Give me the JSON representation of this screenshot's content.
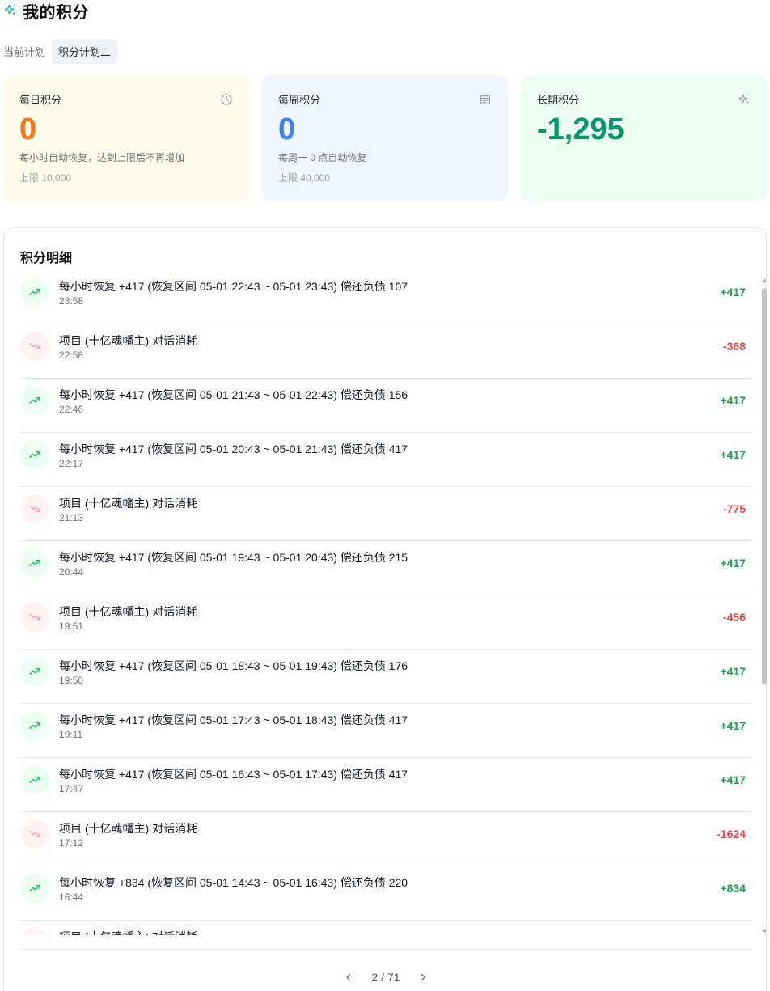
{
  "header": {
    "title": "我的积分"
  },
  "plan": {
    "label": "当前计划",
    "current": "积分计划二"
  },
  "cards": {
    "daily": {
      "label": "每日积分",
      "value": "0",
      "desc": "每小时自动恢复，达到上限后不再增加",
      "limit": "上限 10,000",
      "icon": "clock-icon"
    },
    "weekly": {
      "label": "每周积分",
      "value": "0",
      "desc": "每周一 0 点自动恢复",
      "limit": "上限 40,000",
      "icon": "calendar-icon"
    },
    "long": {
      "label": "长期积分",
      "value": "-1,295",
      "icon": "sparkle-icon"
    }
  },
  "details": {
    "title": "积分明细",
    "rows": [
      {
        "type": "up",
        "desc": "每小时恢复 +417 (恢复区间 05-01 22:43 ~ 05-01 23:43) 偿还负债 107",
        "time": "23:58",
        "amount": "+417"
      },
      {
        "type": "down",
        "desc": "项目 (十亿魂幡主) 对话消耗",
        "time": "22:58",
        "amount": "-368"
      },
      {
        "type": "up",
        "desc": "每小时恢复 +417 (恢复区间 05-01 21:43 ~ 05-01 22:43) 偿还负债 156",
        "time": "22:46",
        "amount": "+417"
      },
      {
        "type": "up",
        "desc": "每小时恢复 +417 (恢复区间 05-01 20:43 ~ 05-01 21:43) 偿还负债 417",
        "time": "22:17",
        "amount": "+417"
      },
      {
        "type": "down",
        "desc": "项目 (十亿魂幡主) 对话消耗",
        "time": "21:13",
        "amount": "-775"
      },
      {
        "type": "up",
        "desc": "每小时恢复 +417 (恢复区间 05-01 19:43 ~ 05-01 20:43) 偿还负债 215",
        "time": "20:44",
        "amount": "+417"
      },
      {
        "type": "down",
        "desc": "项目 (十亿魂幡主) 对话消耗",
        "time": "19:51",
        "amount": "-456"
      },
      {
        "type": "up",
        "desc": "每小时恢复 +417 (恢复区间 05-01 18:43 ~ 05-01 19:43) 偿还负债 176",
        "time": "19:50",
        "amount": "+417"
      },
      {
        "type": "up",
        "desc": "每小时恢复 +417 (恢复区间 05-01 17:43 ~ 05-01 18:43) 偿还负债 417",
        "time": "19:11",
        "amount": "+417"
      },
      {
        "type": "up",
        "desc": "每小时恢复 +417 (恢复区间 05-01 16:43 ~ 05-01 17:43) 偿还负债 417",
        "time": "17:47",
        "amount": "+417"
      },
      {
        "type": "down",
        "desc": "项目 (十亿魂幡主) 对话消耗",
        "time": "17:12",
        "amount": "-1624"
      },
      {
        "type": "up",
        "desc": "每小时恢复 +834 (恢复区间 05-01 14:43 ~ 05-01 16:43) 偿还负债 220",
        "time": "16:44",
        "amount": "+834"
      },
      {
        "type": "down",
        "desc": "项目 (十亿魂幡主) 对话消耗",
        "time": "",
        "amount": ""
      }
    ]
  },
  "pagination": {
    "text": "2 / 71",
    "prev_icon": "chevron-left-icon",
    "next_icon": "chevron-right-icon"
  }
}
